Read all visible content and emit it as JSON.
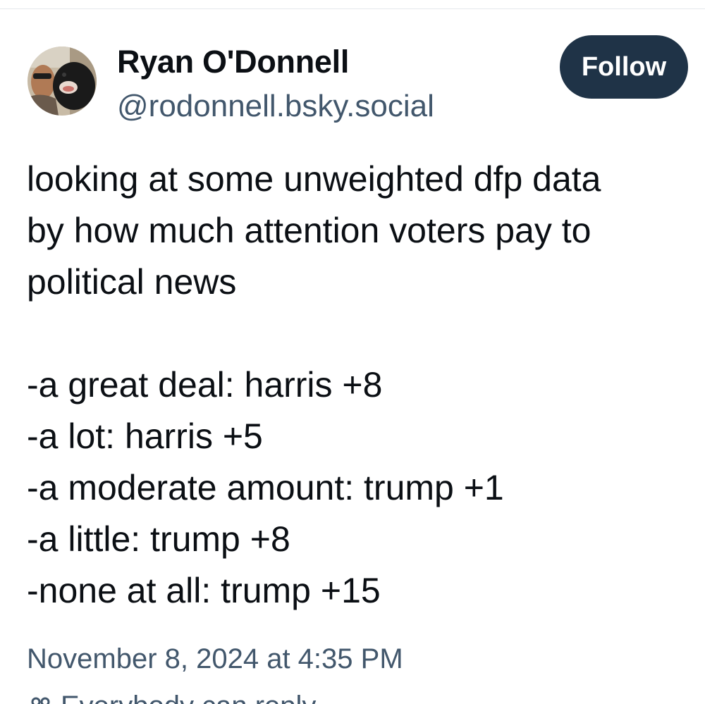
{
  "author": {
    "display_name": "Ryan O'Donnell",
    "handle": "@rodonnell.bsky.social",
    "avatar_icon": "avatar-photo"
  },
  "follow_button": {
    "label": "Follow"
  },
  "post": {
    "lines": [
      "looking at some unweighted dfp data",
      "by how much attention voters pay to",
      "political news"
    ],
    "list": [
      "-a great deal: harris +8",
      "-a lot: harris +5",
      "-a moderate amount: trump +1",
      "-a little: trump +8",
      "-none at all: trump +15"
    ],
    "timestamp": "November 8, 2024 at 4:35 PM"
  },
  "reply_setting": {
    "icon": "people-icon",
    "label": "Everybody can reply"
  },
  "colors": {
    "text_primary": "#0b0f14",
    "text_secondary": "#42576c",
    "follow_button_bg": "#1f3347",
    "divider": "#e4e8ec"
  }
}
